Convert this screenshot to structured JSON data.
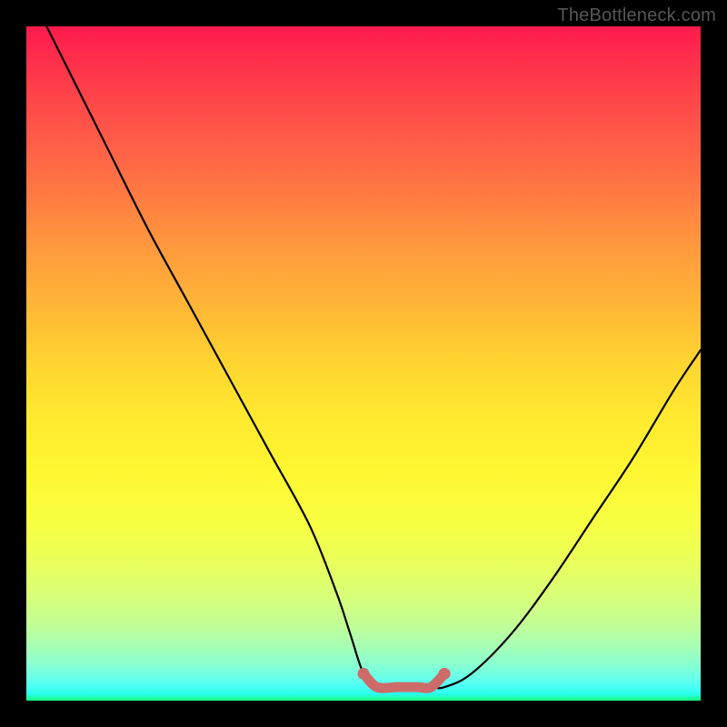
{
  "watermark": "TheBottleneck.com",
  "chart_data": {
    "type": "line",
    "title": "",
    "xlabel": "",
    "ylabel": "",
    "xlim": [
      0,
      100
    ],
    "ylim": [
      0,
      100
    ],
    "series": [
      {
        "name": "curve",
        "x": [
          3,
          6,
          12,
          18,
          24,
          30,
          36,
          42,
          46,
          48,
          50,
          52,
          55,
          58,
          60,
          62,
          66,
          72,
          78,
          84,
          90,
          96,
          100
        ],
        "values": [
          100,
          94,
          82,
          70,
          59,
          48,
          37,
          26,
          16,
          10,
          4,
          2,
          2,
          2,
          2,
          2,
          4,
          10,
          18,
          27,
          36,
          46,
          52
        ]
      },
      {
        "name": "flat-highlight",
        "x": [
          50,
          52,
          55,
          58,
          60,
          62
        ],
        "values": [
          4,
          2,
          2,
          2,
          2,
          4
        ]
      }
    ],
    "flat_segment": {
      "x_start": 50,
      "x_end": 62,
      "y": 2
    }
  }
}
